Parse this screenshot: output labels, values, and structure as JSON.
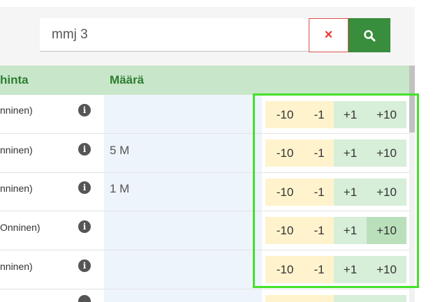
{
  "search": {
    "value": "mmj 3",
    "clear_label": "×"
  },
  "table": {
    "columns": {
      "name": "hinta",
      "quantity": "Määrä"
    },
    "rows": [
      {
        "name": "nninen)",
        "quantity": ""
      },
      {
        "name": "nninen)",
        "quantity": "5 M"
      },
      {
        "name": "nninen)",
        "quantity": "1 M"
      },
      {
        "name": "Onninen)",
        "quantity": ""
      },
      {
        "name": "nninen)",
        "quantity": ""
      }
    ],
    "buttons": {
      "minus10": "-10",
      "minus1": "-1",
      "plus1": "+1",
      "plus10": "+10"
    },
    "info_glyph": "i"
  },
  "colors": {
    "accent": "#388e3c",
    "header_bg": "#c8e6c9",
    "highlight": "#44e12a",
    "clear": "#e53935"
  }
}
